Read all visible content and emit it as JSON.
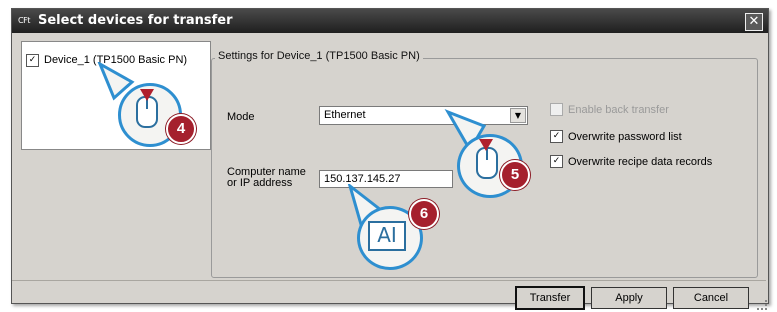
{
  "dialog": {
    "title": "Select devices for transfer",
    "title_icon_text": "CFt",
    "close_symbol": "✕"
  },
  "device_list": {
    "items": [
      {
        "label": "Device_1 (TP1500 Basic PN)",
        "checked": true,
        "check_glyph": "✓"
      }
    ]
  },
  "settings": {
    "group_title": "Settings for Device_1 (TP1500 Basic PN)",
    "mode_label": "Mode",
    "mode_value": "Ethernet",
    "address_label_line1": "Computer name",
    "address_label_line2": "or IP address",
    "address_value": "150.137.145.27",
    "options": [
      {
        "label": "Enable back transfer",
        "checked": false,
        "enabled": false
      },
      {
        "label": "Overwrite password list",
        "checked": true,
        "enabled": true
      },
      {
        "label": "Overwrite recipe data records",
        "checked": true,
        "enabled": true
      }
    ]
  },
  "buttons": {
    "transfer": "Transfer",
    "apply": "Apply",
    "cancel": "Cancel"
  },
  "callouts": [
    {
      "number": "4",
      "icon": "mouse-click-icon"
    },
    {
      "number": "5",
      "icon": "mouse-click-icon"
    },
    {
      "number": "6",
      "icon": "text-input-icon",
      "text": "AI"
    }
  ],
  "colors": {
    "dialog_bg": "#d6d3ce",
    "titlebar": "#2b2b2b",
    "callout_ring": "#2e8fd0",
    "badge": "#a5202d"
  }
}
